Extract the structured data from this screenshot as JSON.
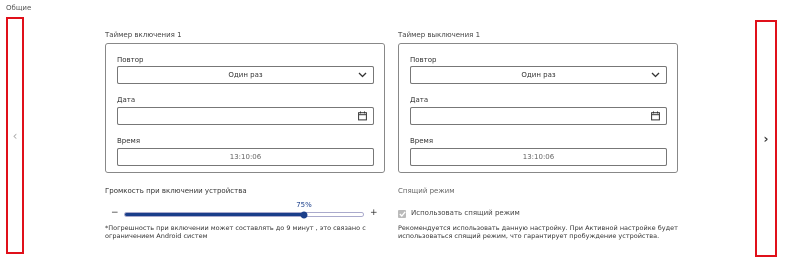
{
  "section": {
    "title": "Общие"
  },
  "nav": {
    "prev_icon": "chevron-left-icon",
    "next_icon": "chevron-right-icon"
  },
  "on_timer": {
    "title": "Таймер включения 1",
    "repeat_label": "Повтор",
    "repeat_value": "Один раз",
    "date_label": "Дата",
    "date_value": "",
    "time_label": "Время",
    "time_value": "13:10:06"
  },
  "off_timer": {
    "title": "Таймер выключения 1",
    "repeat_label": "Повтор",
    "repeat_value": "Один раз",
    "date_label": "Дата",
    "date_value": "",
    "time_label": "Время",
    "time_value": "13:10:06"
  },
  "volume": {
    "label": "Громкость при включении устройства",
    "value": 75,
    "value_text": "75%",
    "minus": "−",
    "plus": "+",
    "note": "*Погрешность при включении может составлять до 9 минут , это связано с ограничением Android систем"
  },
  "sleep": {
    "label": "Спящий режим",
    "checkbox_label": "Использовать спящий режим",
    "checked": true,
    "description": "Рекомендуется использовать данную настройку. При Активной настройке будет использоваться спящий режим, что гарантирует пробуждение устройства."
  },
  "colors": {
    "accent": "#1a3e8a",
    "highlight_border": "#e0101a"
  }
}
